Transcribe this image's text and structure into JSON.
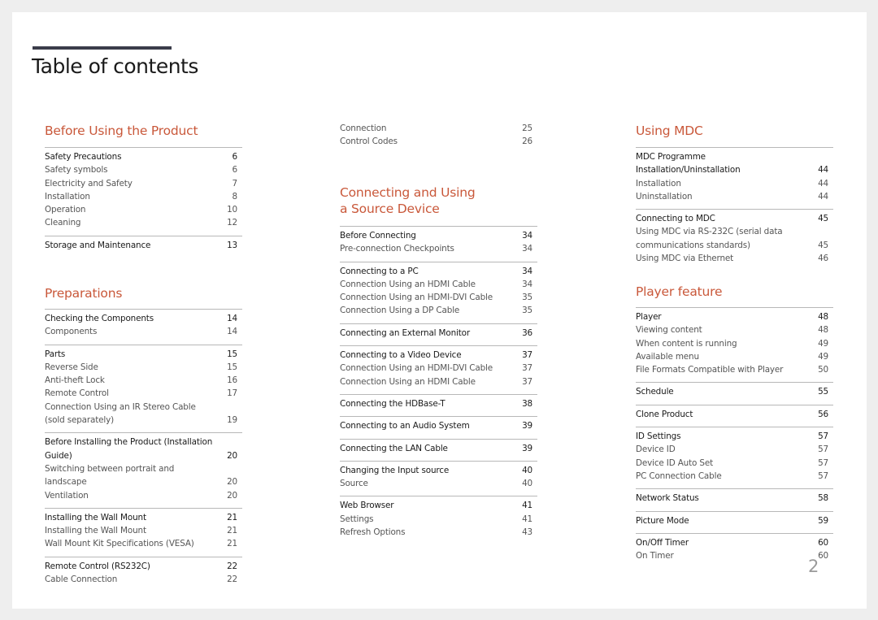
{
  "page_title": "Table of contents",
  "page_number": "2",
  "colors": {
    "section_title": "#c9583a",
    "title_bar": "#3b3c4a"
  },
  "columns": [
    {
      "sections": [
        {
          "title": "Before Using the Product",
          "groups": [
            {
              "items": [
                {
                  "label": "Safety Precautions",
                  "page": "6",
                  "head": true
                },
                {
                  "label": "Safety symbols",
                  "page": "6"
                },
                {
                  "label": "Electricity and Safety",
                  "page": "7"
                },
                {
                  "label": "Installation",
                  "page": "8"
                },
                {
                  "label": "Operation",
                  "page": "10"
                },
                {
                  "label": "Cleaning",
                  "page": "12"
                }
              ]
            },
            {
              "items": [
                {
                  "label": "Storage and Maintenance",
                  "page": "13",
                  "head": true
                }
              ]
            }
          ]
        },
        {
          "title": "Preparations",
          "groups": [
            {
              "items": [
                {
                  "label": "Checking the Components",
                  "page": "14",
                  "head": true
                },
                {
                  "label": "Components",
                  "page": "14"
                }
              ]
            },
            {
              "items": [
                {
                  "label": "Parts",
                  "page": "15",
                  "head": true
                },
                {
                  "label": "Reverse Side",
                  "page": "15"
                },
                {
                  "label": "Anti-theft Lock",
                  "page": "16"
                },
                {
                  "label": "Remote Control",
                  "page": "17"
                },
                {
                  "label": "Connection Using an IR Stereo Cable (sold separately)",
                  "page": "19"
                }
              ]
            },
            {
              "items": [
                {
                  "label": "Before Installing the Product (Installation Guide)",
                  "page": "20",
                  "head": true
                },
                {
                  "label": "Switching between portrait and landscape",
                  "page": "20"
                },
                {
                  "label": "Ventilation",
                  "page": "20"
                }
              ]
            },
            {
              "items": [
                {
                  "label": "Installing the Wall Mount",
                  "page": "21",
                  "head": true
                },
                {
                  "label": "Installing the Wall Mount",
                  "page": "21"
                },
                {
                  "label": "Wall Mount Kit Specifications (VESA)",
                  "page": "21"
                }
              ]
            },
            {
              "items": [
                {
                  "label": "Remote Control (RS232C)",
                  "page": "22",
                  "head": true
                },
                {
                  "label": "Cable Connection",
                  "page": "22"
                }
              ]
            }
          ]
        }
      ]
    },
    {
      "sections": [
        {
          "title": "",
          "groups": [
            {
              "items": [
                {
                  "label": "Connection",
                  "page": "25"
                },
                {
                  "label": "Control Codes",
                  "page": "26"
                }
              ]
            }
          ]
        },
        {
          "title": "Connecting and Using a Source Device",
          "groups": [
            {
              "items": [
                {
                  "label": "Before Connecting",
                  "page": "34",
                  "head": true
                },
                {
                  "label": "Pre-connection Checkpoints",
                  "page": "34"
                }
              ]
            },
            {
              "items": [
                {
                  "label": "Connecting to a PC",
                  "page": "34",
                  "head": true
                },
                {
                  "label": "Connection Using an HDMI Cable",
                  "page": "34"
                },
                {
                  "label": "Connection Using an HDMI-DVI Cable",
                  "page": "35"
                },
                {
                  "label": "Connection Using a DP Cable",
                  "page": "35"
                }
              ]
            },
            {
              "items": [
                {
                  "label": "Connecting an External Monitor",
                  "page": "36",
                  "head": true
                }
              ]
            },
            {
              "items": [
                {
                  "label": "Connecting to a Video Device",
                  "page": "37",
                  "head": true
                },
                {
                  "label": "Connection Using an HDMI-DVI Cable",
                  "page": "37"
                },
                {
                  "label": "Connection Using an HDMI Cable",
                  "page": "37"
                }
              ]
            },
            {
              "items": [
                {
                  "label": "Connecting the HDBase-T",
                  "page": "38",
                  "head": true
                }
              ]
            },
            {
              "items": [
                {
                  "label": "Connecting to an Audio System",
                  "page": "39",
                  "head": true
                }
              ]
            },
            {
              "items": [
                {
                  "label": "Connecting the LAN Cable",
                  "page": "39",
                  "head": true
                }
              ]
            },
            {
              "items": [
                {
                  "label": "Changing the Input source",
                  "page": "40",
                  "head": true
                },
                {
                  "label": "Source",
                  "page": "40"
                }
              ]
            },
            {
              "items": [
                {
                  "label": "Web Browser",
                  "page": "41",
                  "head": true
                },
                {
                  "label": "Settings",
                  "page": "41"
                },
                {
                  "label": "Refresh Options",
                  "page": "43"
                }
              ]
            }
          ]
        }
      ]
    },
    {
      "sections": [
        {
          "title": "Using MDC",
          "groups": [
            {
              "items": [
                {
                  "label": "MDC Programme Installation/Uninstallation",
                  "page": "44",
                  "head": true
                },
                {
                  "label": "Installation",
                  "page": "44"
                },
                {
                  "label": "Uninstallation",
                  "page": "44"
                }
              ]
            },
            {
              "items": [
                {
                  "label": "Connecting to MDC",
                  "page": "45",
                  "head": true
                },
                {
                  "label": "Using MDC via RS-232C (serial data communications standards)",
                  "page": "45"
                },
                {
                  "label": "Using MDC via Ethernet",
                  "page": "46"
                }
              ]
            }
          ]
        },
        {
          "title": "Player feature",
          "groups": [
            {
              "items": [
                {
                  "label": "Player",
                  "page": "48",
                  "head": true
                },
                {
                  "label": "Viewing content",
                  "page": "48"
                },
                {
                  "label": "When content is running",
                  "page": "49"
                },
                {
                  "label": "Available menu",
                  "page": "49"
                },
                {
                  "label": "File Formats Compatible with Player",
                  "page": "50"
                }
              ]
            },
            {
              "items": [
                {
                  "label": "Schedule",
                  "page": "55",
                  "head": true
                }
              ]
            },
            {
              "items": [
                {
                  "label": "Clone Product",
                  "page": "56",
                  "head": true
                }
              ]
            },
            {
              "items": [
                {
                  "label": "ID Settings",
                  "page": "57",
                  "head": true
                },
                {
                  "label": "Device ID",
                  "page": "57"
                },
                {
                  "label": "Device ID Auto Set",
                  "page": "57"
                },
                {
                  "label": "PC Connection Cable",
                  "page": "57"
                }
              ]
            },
            {
              "items": [
                {
                  "label": "Network Status",
                  "page": "58",
                  "head": true
                }
              ]
            },
            {
              "items": [
                {
                  "label": "Picture Mode",
                  "page": "59",
                  "head": true
                }
              ]
            },
            {
              "items": [
                {
                  "label": "On/Off Timer",
                  "page": "60",
                  "head": true
                },
                {
                  "label": "On Timer",
                  "page": "60"
                }
              ]
            }
          ]
        }
      ]
    }
  ]
}
